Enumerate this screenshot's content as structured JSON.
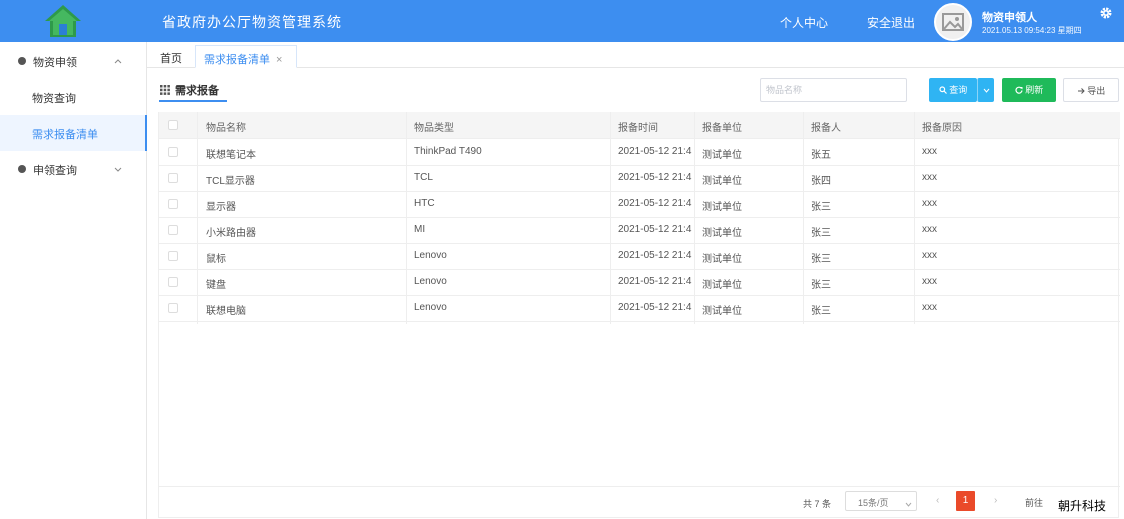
{
  "header": {
    "app_title": "省政府办公厅物资管理系统",
    "personal_center": "个人中心",
    "logout": "安全退出",
    "user_name": "物资申领人",
    "user_time": "2021.05.13 09:54:23 星期四"
  },
  "sidebar": {
    "groups": [
      {
        "label": "物资申领",
        "expanded": true,
        "items": [
          {
            "label": "物资查询",
            "active": false
          },
          {
            "label": "需求报备清单",
            "active": true
          }
        ]
      },
      {
        "label": "申领查询",
        "expanded": false,
        "items": []
      }
    ]
  },
  "tabs": {
    "home": "首页",
    "current": "需求报备清单",
    "close_glyph": "×"
  },
  "panel": {
    "title": "需求报备"
  },
  "toolbar": {
    "search_placeholder": "物品名称",
    "query_label": "查询",
    "refresh_label": "刷新",
    "export_label": "导出"
  },
  "table": {
    "columns": [
      "物品名称",
      "物品类型",
      "报备时间",
      "报备单位",
      "报备人",
      "报备原因"
    ],
    "rows": [
      {
        "name": "联想笔记本",
        "type": "ThinkPad T490",
        "time": "2021-05-12 21:4",
        "unit": "测试单位",
        "person": "张五",
        "reason": "xxx"
      },
      {
        "name": "TCL显示器",
        "type": "TCL",
        "time": "2021-05-12 21:4",
        "unit": "测试单位",
        "person": "张四",
        "reason": "xxx"
      },
      {
        "name": "显示器",
        "type": "HTC",
        "time": "2021-05-12 21:4",
        "unit": "测试单位",
        "person": "张三",
        "reason": "xxx"
      },
      {
        "name": "小米路由器",
        "type": "MI",
        "time": "2021-05-12 21:4",
        "unit": "测试单位",
        "person": "张三",
        "reason": "xxx"
      },
      {
        "name": "鼠标",
        "type": "Lenovo",
        "time": "2021-05-12 21:4",
        "unit": "测试单位",
        "person": "张三",
        "reason": "xxx"
      },
      {
        "name": "键盘",
        "type": "Lenovo",
        "time": "2021-05-12 21:4",
        "unit": "测试单位",
        "person": "张三",
        "reason": "xxx"
      },
      {
        "name": "联想电脑",
        "type": "Lenovo",
        "time": "2021-05-12 21:4",
        "unit": "测试单位",
        "person": "张三",
        "reason": "xxx"
      }
    ]
  },
  "pagination": {
    "total": "共 7 条",
    "page_size": "15条/页",
    "prev": "‹",
    "next": "›",
    "current_page": "1",
    "goto_label": "前往"
  },
  "watermark": "朝升科技",
  "colors": {
    "header_bg": "#3d8ef0",
    "accent": "#3d8ef0",
    "query_btn": "#2fb4f3",
    "refresh_btn": "#1fba5a",
    "page_active": "#ea4a2a"
  },
  "icons": {
    "logo": "house-icon",
    "avatar": "image-placeholder-icon",
    "settings": "gear-icon",
    "menu_bullet": "dot-icon",
    "expand": "chevron-up-icon",
    "collapse": "chevron-down-icon",
    "panel": "grid-icon",
    "query": "search-icon",
    "refresh": "refresh-icon",
    "export": "arrow-right-icon"
  }
}
